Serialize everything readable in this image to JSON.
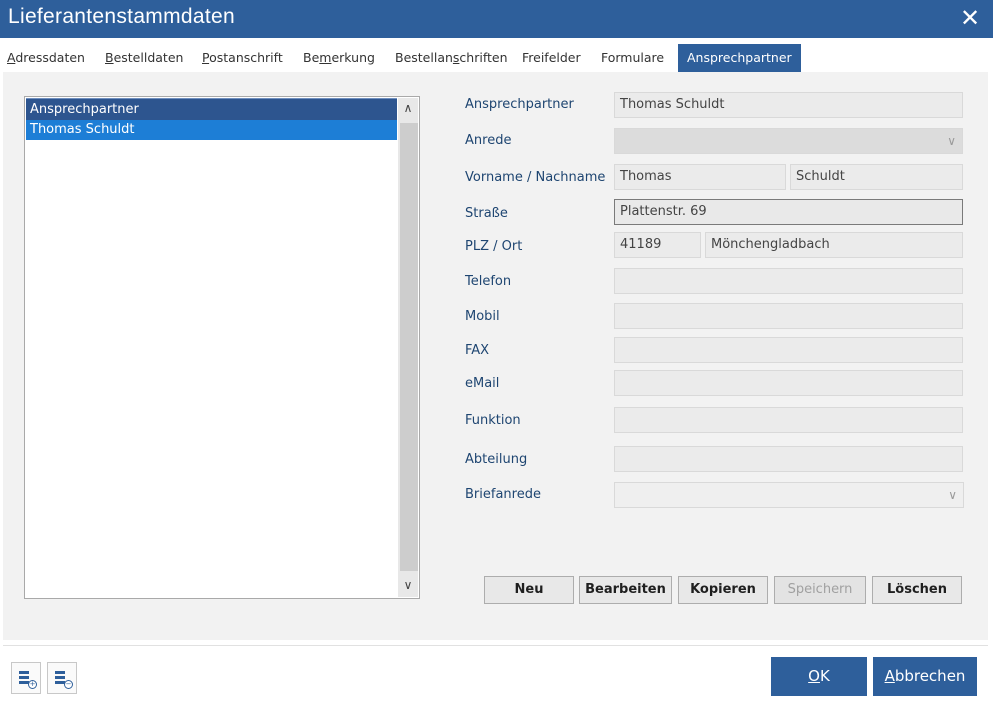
{
  "window": {
    "title": "Lieferantenstammdaten",
    "close_symbol": "✕"
  },
  "tabs": [
    {
      "pre": "",
      "accel": "A",
      "post": "dressdaten"
    },
    {
      "pre": "",
      "accel": "B",
      "post": "estelldaten"
    },
    {
      "pre": "",
      "accel": "P",
      "post": "ostanschrift"
    },
    {
      "pre": "Be",
      "accel": "m",
      "post": "erkung"
    },
    {
      "pre": "Bestellan",
      "accel": "s",
      "post": "chriften"
    },
    {
      "pre": "Freifelder",
      "accel": "",
      "post": ""
    },
    {
      "pre": "Formulare",
      "accel": "",
      "post": ""
    },
    {
      "pre": "Ansprechpartner",
      "accel": "",
      "post": ""
    }
  ],
  "list": {
    "header": "Ansprechpartner",
    "items": [
      "Thomas Schuldt"
    ]
  },
  "form": {
    "labels": {
      "ansprechpartner": "Ansprechpartner",
      "anrede": "Anrede",
      "name": "Vorname / Nachname",
      "strasse": "Straße",
      "plz_ort": "PLZ / Ort",
      "telefon": "Telefon",
      "mobil": "Mobil",
      "fax": "FAX",
      "email": "eMail",
      "funktion": "Funktion",
      "abteilung": "Abteilung",
      "briefanrede": "Briefanrede"
    },
    "values": {
      "ansprechpartner": "Thomas Schuldt",
      "anrede": "",
      "vorname": "Thomas",
      "nachname": "Schuldt",
      "strasse": "Plattenstr. 69",
      "plz": "41189",
      "ort": "Mönchengladbach",
      "telefon": "",
      "mobil": "",
      "fax": "",
      "email": "",
      "funktion": "",
      "abteilung": "",
      "briefanrede": ""
    }
  },
  "buttons": {
    "neu": "Neu",
    "bearbeiten": "Bearbeiten",
    "kopieren": "Kopieren",
    "speichern": "Speichern",
    "loeschen": "Löschen"
  },
  "footer": {
    "ok_accel": "O",
    "ok_rest": "K",
    "cancel_accel": "A",
    "cancel_rest": "bbrechen"
  },
  "icons": {
    "close": "close-icon",
    "list_add": "list-add-icon",
    "list_remove": "list-remove-icon",
    "scroll_up": "chevron-up-icon",
    "scroll_down": "chevron-down-icon",
    "combo": "chevron-down-icon"
  },
  "colors": {
    "accent": "#2e5f9b",
    "selection": "#1d7ed6",
    "label": "#1e4571"
  }
}
